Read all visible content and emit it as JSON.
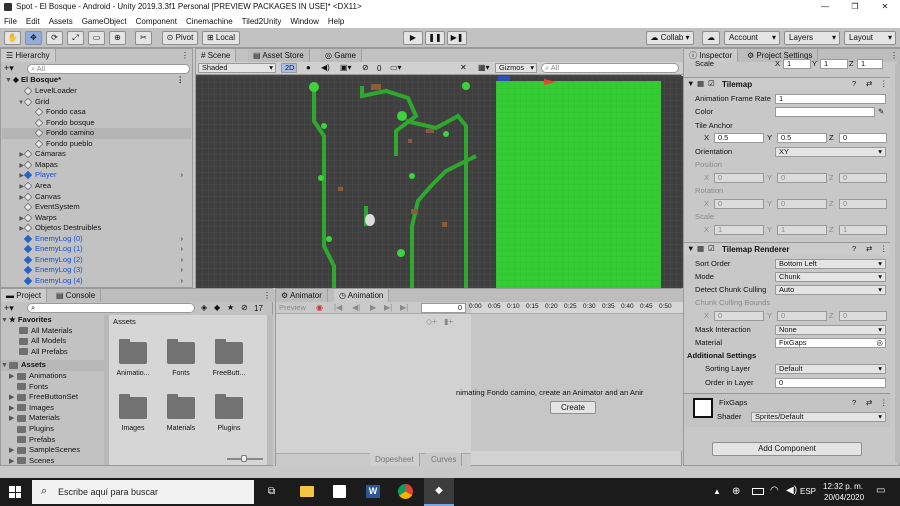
{
  "window": {
    "title": "Spot - El Bosque - Android - Unity 2019.3.3f1 Personal [PREVIEW PACKAGES IN USE]* <DX11>"
  },
  "menu": [
    "File",
    "Edit",
    "Assets",
    "GameObject",
    "Component",
    "Cinemachine",
    "Tiled2Unity",
    "Window",
    "Help"
  ],
  "toolbar": {
    "pivot": "Pivot",
    "local": "Local",
    "collab": "Collab ▾",
    "account": "Account",
    "layers": "Layers",
    "layout": "Layout"
  },
  "hierarchy": {
    "tab": "Hierarchy",
    "search_placeholder": "All",
    "scene": "El Bosque*",
    "items": [
      {
        "label": "LevelLoader",
        "indent": 2,
        "prefab": false
      },
      {
        "label": "Grid",
        "indent": 2,
        "prefab": false,
        "expanded": true
      },
      {
        "label": "Fondo casa",
        "indent": 3,
        "prefab": false
      },
      {
        "label": "Fondo bosque",
        "indent": 3,
        "prefab": false
      },
      {
        "label": "Fondo camino",
        "indent": 3,
        "prefab": false,
        "selected": true
      },
      {
        "label": "Fondo pueblo",
        "indent": 3,
        "prefab": false
      },
      {
        "label": "Cámaras",
        "indent": 2,
        "prefab": false,
        "collapsed": true
      },
      {
        "label": "Mapas",
        "indent": 2,
        "prefab": false,
        "collapsed": true
      },
      {
        "label": "Player",
        "indent": 2,
        "prefab": true,
        "collapsed": true
      },
      {
        "label": "Area",
        "indent": 2,
        "prefab": false,
        "collapsed": true
      },
      {
        "label": "Canvas",
        "indent": 2,
        "prefab": false,
        "collapsed": true
      },
      {
        "label": "EventSystem",
        "indent": 2,
        "prefab": false
      },
      {
        "label": "Warps",
        "indent": 2,
        "prefab": false,
        "collapsed": true
      },
      {
        "label": "Objetos Destruibles",
        "indent": 2,
        "prefab": false,
        "collapsed": true
      },
      {
        "label": "EnemyLog (0)",
        "indent": 2,
        "prefab": true
      },
      {
        "label": "EnemyLog (1)",
        "indent": 2,
        "prefab": true
      },
      {
        "label": "EnemyLog (2)",
        "indent": 2,
        "prefab": true
      },
      {
        "label": "EnemyLog (3)",
        "indent": 2,
        "prefab": true
      },
      {
        "label": "EnemyLog (4)",
        "indent": 2,
        "prefab": true
      }
    ]
  },
  "scene": {
    "tabs": [
      "Scene",
      "Asset Store",
      "Game"
    ],
    "shading": "Shaded",
    "mode2d": "2D",
    "gizmos": "Gizmos",
    "search_placeholder": "All",
    "count": "0"
  },
  "project": {
    "tabs": [
      "Project",
      "Console"
    ],
    "count": "17",
    "favorites": {
      "label": "Favorites",
      "items": [
        "All Materials",
        "All Models",
        "All Prefabs"
      ]
    },
    "assets": {
      "label": "Assets",
      "items": [
        "Animations",
        "Fonts",
        "FreeButtonSet",
        "Images",
        "Materials",
        "Plugins",
        "Prefabs",
        "SampleScenes",
        "Scenes"
      ]
    },
    "breadcrumb": "Assets",
    "grid": [
      "Animatio...",
      "Fonts",
      "FreeButt...",
      "Images",
      "Materials",
      "Plugins"
    ]
  },
  "animation": {
    "tabs": [
      "Animator",
      "Animation"
    ],
    "preview": "Preview",
    "frame": "0",
    "timeline": [
      "0:00",
      "0:05",
      "0:10",
      "0:15",
      "0:20",
      "0:25",
      "0:30",
      "0:35",
      "0:40",
      "0:45",
      "0:50"
    ],
    "message": "nimating Fondo camino, create an Animator and an Anir",
    "create": "Create",
    "bottom_tabs": [
      "Dopesheet",
      "Curves"
    ]
  },
  "inspector": {
    "tabs": [
      "Inspector",
      "Project Settings"
    ],
    "scale": {
      "label": "Scale",
      "x": "1",
      "y": "1",
      "z": "1"
    },
    "tilemap": {
      "title": "Tilemap",
      "frame_rate_label": "Animation Frame Rate",
      "frame_rate": "1",
      "color_label": "Color",
      "anchor_label": "Tile Anchor",
      "anchor": {
        "x": "0.5",
        "y": "0.5",
        "z": "0"
      },
      "orientation_label": "Orientation",
      "orientation": "XY",
      "position_label": "Position",
      "position": {
        "x": "0",
        "y": "0",
        "z": "0"
      },
      "rotation_label": "Rotation",
      "rotation": {
        "x": "0",
        "y": "0",
        "z": "0"
      },
      "scale_label": "Scale",
      "scale": {
        "x": "1",
        "y": "1",
        "z": "1"
      }
    },
    "renderer": {
      "title": "Tilemap Renderer",
      "sort_order_label": "Sort Order",
      "sort_order": "Bottom Left",
      "mode_label": "Mode",
      "mode": "Chunk",
      "culling_label": "Detect Chunk Culling",
      "culling": "Auto",
      "bounds_label": "Chunk Culling Bounds",
      "bounds": {
        "x": "0",
        "y": "0",
        "z": "0"
      },
      "mask_label": "Mask Interaction",
      "mask": "None",
      "material_label": "Material",
      "material": "FixGaps",
      "additional_label": "Additional Settings",
      "sorting_layer_label": "Sorting Layer",
      "sorting_layer": "Default",
      "order_label": "Order in Layer",
      "order": "0"
    },
    "material": {
      "name": "FixGaps",
      "shader_label": "Shader",
      "shader": "Sprites/Default"
    },
    "add_component": "Add Component"
  },
  "taskbar": {
    "search": "Escribe aquí para buscar",
    "lang": "ESP",
    "time": "12:32 p. m.",
    "date": "20/04/2020"
  },
  "colors": {
    "scene_green": "#33cc33",
    "path_green": "#2fa82f",
    "unity_blue": "#1a4fd6"
  }
}
